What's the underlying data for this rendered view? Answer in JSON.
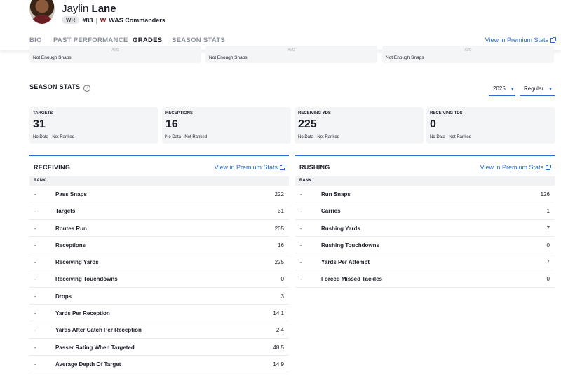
{
  "player": {
    "first_name": "Jaylin",
    "last_name": "Lane",
    "position": "WR",
    "number": "#83",
    "team": "WAS Commanders",
    "team_icon": "commanders-w-logo"
  },
  "tabs": [
    {
      "label": "BIO",
      "active": false
    },
    {
      "label": "PAST PERFORMANCE",
      "active": false
    },
    {
      "label": "GRADES",
      "active": true
    },
    {
      "label": "SEASON STATS",
      "active": false
    }
  ],
  "premium_link": "View in Premium Stats",
  "grade_cards": [
    {
      "avg": "AVG",
      "status": "Not Enough Snaps"
    },
    {
      "avg": "AVG",
      "status": "Not Enough Snaps"
    },
    {
      "avg": "AVG",
      "status": "Not Enough Snaps"
    }
  ],
  "season_stats": {
    "title": "SEASON STATS",
    "help": "?",
    "year": "2025",
    "season_type": "Regular"
  },
  "stat_cards": [
    {
      "label": "TARGETS",
      "value": "31",
      "rank": "No Data - Not Ranked"
    },
    {
      "label": "RECEPTIONS",
      "value": "16",
      "rank": "No Data - Not Ranked"
    },
    {
      "label": "RECEIVING YDS",
      "value": "225",
      "rank": "No Data - Not Ranked"
    },
    {
      "label": "RECEIVING TDS",
      "value": "0",
      "rank": "No Data - Not Ranked"
    }
  ],
  "receiving": {
    "title": "RECEIVING",
    "link": "View in Premium Stats",
    "rank_header": "RANK",
    "rows": [
      {
        "rank": "-",
        "name": "Pass Snaps",
        "value": "222"
      },
      {
        "rank": "-",
        "name": "Targets",
        "value": "31"
      },
      {
        "rank": "-",
        "name": "Routes Run",
        "value": "205"
      },
      {
        "rank": "-",
        "name": "Receptions",
        "value": "16"
      },
      {
        "rank": "-",
        "name": "Receiving Yards",
        "value": "225"
      },
      {
        "rank": "-",
        "name": "Receiving Touchdowns",
        "value": "0"
      },
      {
        "rank": "-",
        "name": "Drops",
        "value": "3"
      },
      {
        "rank": "-",
        "name": "Yards Per Reception",
        "value": "14.1"
      },
      {
        "rank": "-",
        "name": "Yards After Catch Per Reception",
        "value": "2.4"
      },
      {
        "rank": "-",
        "name": "Passer Rating When Targeted",
        "value": "48.5"
      },
      {
        "rank": "-",
        "name": "Average Depth Of Target",
        "value": "14.9"
      }
    ]
  },
  "rushing": {
    "title": "RUSHING",
    "link": "View in Premium Stats",
    "rank_header": "RANK",
    "rows": [
      {
        "rank": "-",
        "name": "Run Snaps",
        "value": "126"
      },
      {
        "rank": "-",
        "name": "Carries",
        "value": "1"
      },
      {
        "rank": "-",
        "name": "Rushing Yards",
        "value": "7"
      },
      {
        "rank": "-",
        "name": "Rushing Touchdowns",
        "value": "0"
      },
      {
        "rank": "-",
        "name": "Yards Per Attempt",
        "value": "7"
      },
      {
        "rank": "-",
        "name": "Forced Missed Tackles",
        "value": "0"
      }
    ]
  },
  "colors": {
    "accent": "#2a6bd8",
    "card_bg": "#f4f5f7",
    "team": "#7b1c23"
  }
}
